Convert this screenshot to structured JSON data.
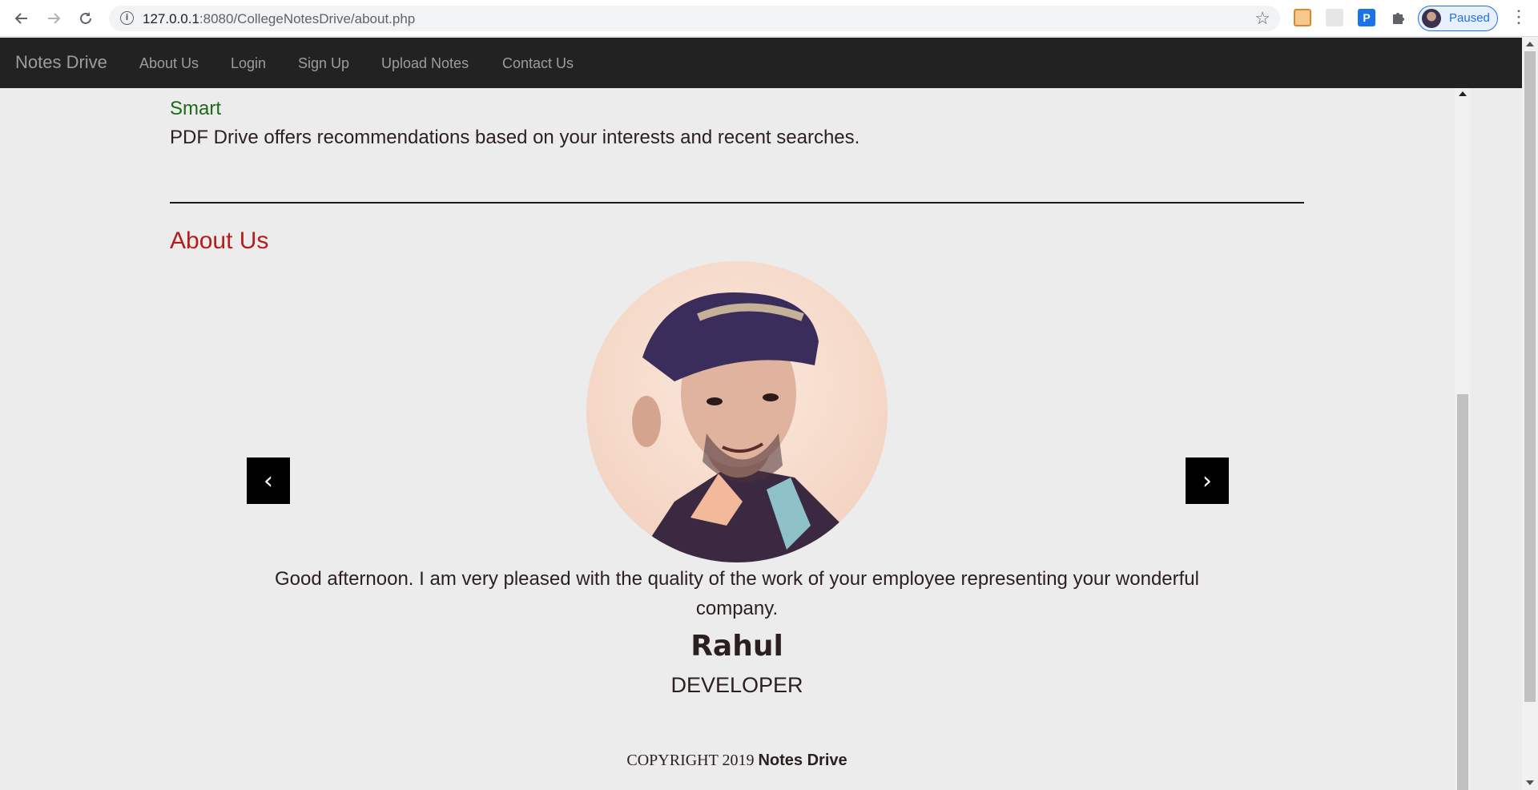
{
  "browser": {
    "url_host": "127.0.0.1",
    "url_rest": ":8080/CollegeNotesDrive/about.php",
    "profile_label": "Paused"
  },
  "navbar": {
    "brand": "Notes Drive",
    "links": [
      "About Us",
      "Login",
      "Sign Up",
      "Upload Notes",
      "Contact Us"
    ]
  },
  "features": {
    "smart_title": "Smart",
    "smart_desc": "PDF Drive offers recommendations based on your interests and recent searches."
  },
  "about": {
    "title": "About Us",
    "quote": "Good afternoon. I am very pleased with the quality of the work of your employee representing your wonderful company.",
    "name": "Rahul",
    "role": "DEVELOPER",
    "prev": "‹",
    "next": "›"
  },
  "footer": {
    "copyright_prefix": "COPYRIGHT 2019",
    "copyright_brand": "Notes Drive"
  },
  "colors": {
    "navbar_bg": "#222222",
    "smart_title": "#1a6b1a",
    "about_title": "#b71c1c",
    "page_bg": "#ececec"
  }
}
